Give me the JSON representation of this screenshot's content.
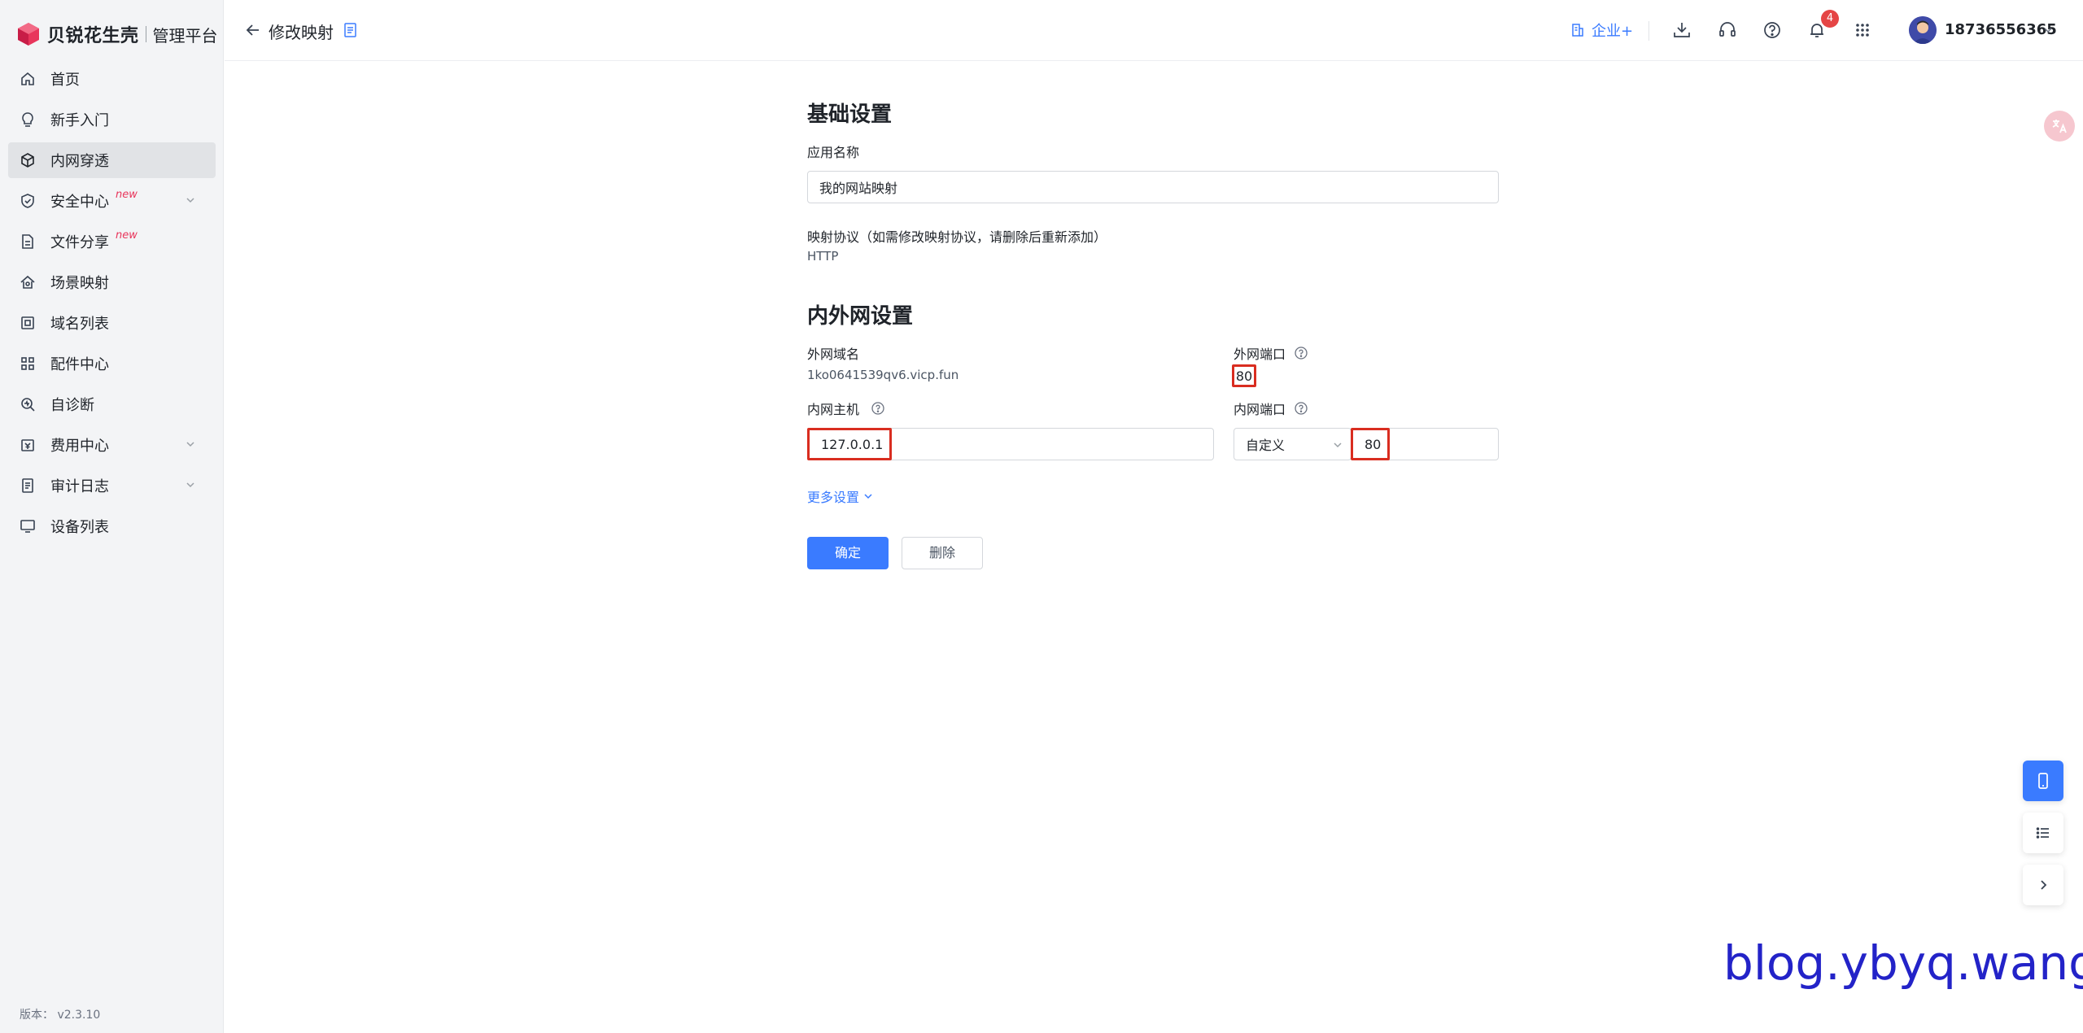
{
  "brand": {
    "name": "贝锐花生壳",
    "subtitle": "管理平台"
  },
  "sidebar": {
    "items": [
      {
        "label": "首页",
        "icon": "home-icon"
      },
      {
        "label": "新手入门",
        "icon": "lightbulb-icon"
      },
      {
        "label": "内网穿透",
        "icon": "cube-icon",
        "active": true
      },
      {
        "label": "安全中心",
        "icon": "shield-icon",
        "badge": "new",
        "expandable": true
      },
      {
        "label": "文件分享",
        "icon": "file-share-icon",
        "badge": "new"
      },
      {
        "label": "场景映射",
        "icon": "scene-icon"
      },
      {
        "label": "域名列表",
        "icon": "domain-icon"
      },
      {
        "label": "配件中心",
        "icon": "grid-icon"
      },
      {
        "label": "自诊断",
        "icon": "diagnose-icon"
      },
      {
        "label": "费用中心",
        "icon": "wallet-icon",
        "expandable": true
      },
      {
        "label": "审计日志",
        "icon": "log-icon",
        "expandable": true
      },
      {
        "label": "设备列表",
        "icon": "monitor-icon"
      }
    ],
    "version": "版本： v2.3.10"
  },
  "header": {
    "title": "修改映射",
    "enterprise_label": "企业+",
    "notification_count": "4",
    "username": "18736556365"
  },
  "form": {
    "basic_title": "基础设置",
    "app_name_label": "应用名称",
    "app_name_value": "我的网站映射",
    "protocol_label": "映射协议（如需修改映射协议，请删除后重新添加）",
    "protocol_value": "HTTP",
    "network_title": "内外网设置",
    "ext_domain_label": "外网域名",
    "ext_domain_value": "1ko0641539qv6.vicp.fun",
    "ext_port_label": "外网端口",
    "ext_port_value": "80",
    "int_host_label": "内网主机",
    "int_host_value": "127.0.0.1",
    "int_port_label": "内网端口",
    "int_port_mode": "自定义",
    "int_port_value": "80",
    "more_settings": "更多设置",
    "confirm_label": "确定",
    "delete_label": "删除"
  },
  "watermark": "blog.ybyq.wang",
  "colors": {
    "accent": "#3a7bff",
    "highlight": "#d92d20",
    "brand": "#e8355b"
  }
}
